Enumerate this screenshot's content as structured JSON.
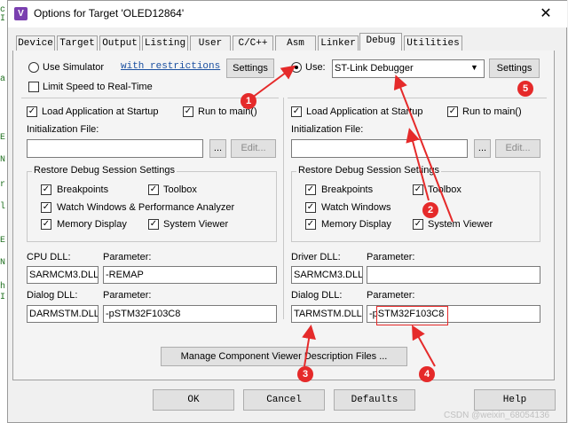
{
  "window": {
    "title": "Options for Target 'OLED12864'",
    "close_glyph": "✕",
    "icon_glyph": "V"
  },
  "bg_editor": {
    "glyphs": [
      "c",
      "I",
      "a",
      "E",
      "N",
      "r",
      "l",
      "E",
      "N",
      "h",
      "I"
    ]
  },
  "tabs": [
    {
      "label": "Device"
    },
    {
      "label": "Target"
    },
    {
      "label": "Output"
    },
    {
      "label": "Listing"
    },
    {
      "label": "User"
    },
    {
      "label": "C/C++"
    },
    {
      "label": "Asm"
    },
    {
      "label": "Linker"
    },
    {
      "label": "Debug",
      "active": true
    },
    {
      "label": "Utilities"
    }
  ],
  "left": {
    "use_simulator": "Use Simulator",
    "with_restrictions": "with restrictions",
    "settings": "Settings",
    "limit_speed": "Limit Speed to Real-Time",
    "load_app": "Load Application at Startup",
    "run_to_main": "Run to main()",
    "init_file_label": "Initialization File:",
    "browse": "...",
    "edit": "Edit...",
    "restore_group": "Restore Debug Session Settings",
    "breakpoints": "Breakpoints",
    "toolbox": "Toolbox",
    "watch_windows": "Watch Windows & Performance Analyzer",
    "memory_display": "Memory Display",
    "system_viewer": "System Viewer",
    "cpu_dll_label": "CPU DLL:",
    "parameter_label": "Parameter:",
    "cpu_dll": "SARMCM3.DLL",
    "cpu_param": "-REMAP",
    "dialog_dll_label": "Dialog DLL:",
    "dialog_dll": "DARMSTM.DLL",
    "dialog_param": "-pSTM32F103C8"
  },
  "right": {
    "use": "Use:",
    "debugger": "ST-Link Debugger",
    "dropdown_glyph": "▼",
    "settings": "Settings",
    "load_app": "Load Application at Startup",
    "run_to_main": "Run to main()",
    "init_file_label": "Initialization File:",
    "browse": "...",
    "edit": "Edit...",
    "restore_group": "Restore Debug Session Settings",
    "breakpoints": "Breakpoints",
    "toolbox": "Toolbox",
    "watch_windows": "Watch Windows",
    "memory_display": "Memory Display",
    "system_viewer": "System Viewer",
    "driver_dll_label": "Driver DLL:",
    "parameter_label": "Parameter:",
    "driver_dll": "SARMCM3.DLL",
    "driver_param": "",
    "dialog_dll_label": "Dialog DLL:",
    "dialog_dll": "TARMSTM.DLL",
    "dialog_param": "-pSTM32F103C8"
  },
  "checks": {
    "check_glyph": "✓"
  },
  "manage_button": "Manage Component Viewer Description Files ...",
  "footer": {
    "ok": "OK",
    "cancel": "Cancel",
    "defaults": "Defaults",
    "help": "Help"
  },
  "annotations": {
    "b1": "1",
    "b2": "2",
    "b3": "3",
    "b4": "4",
    "b5": "5",
    "color": "#e52a2a"
  },
  "watermark": "CSDN @weixin_68054136"
}
